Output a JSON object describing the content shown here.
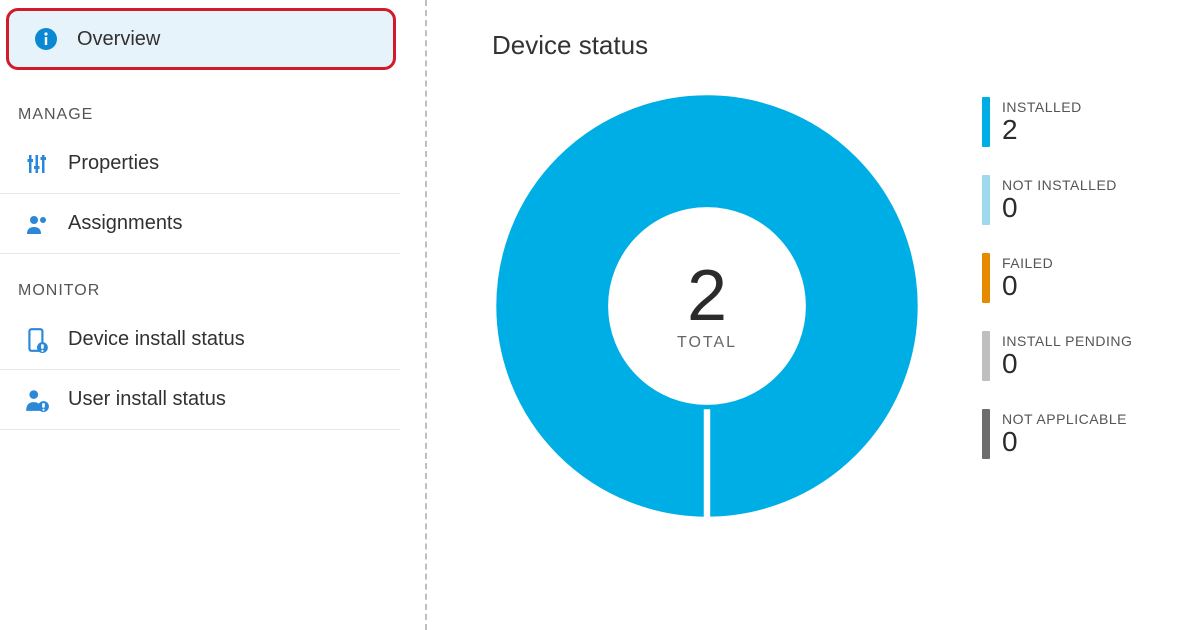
{
  "sidebar": {
    "overview_label": "Overview",
    "sections": {
      "manage": {
        "header": "MANAGE",
        "properties": "Properties",
        "assignments": "Assignments"
      },
      "monitor": {
        "header": "MONITOR",
        "device_install_status": "Device install status",
        "user_install_status": "User install status"
      }
    }
  },
  "panel": {
    "title": "Device status",
    "total_value": "2",
    "total_label": "TOTAL"
  },
  "legend": {
    "installed": {
      "label": "INSTALLED",
      "value": "2",
      "color": "#00aee6"
    },
    "not_installed": {
      "label": "NOT INSTALLED",
      "value": "0",
      "color": "#9ed9ec"
    },
    "failed": {
      "label": "FAILED",
      "value": "0",
      "color": "#e68a00"
    },
    "install_pending": {
      "label": "INSTALL PENDING",
      "value": "0",
      "color": "#bfbfbf"
    },
    "not_applicable": {
      "label": "NOT APPLICABLE",
      "value": "0",
      "color": "#6d6d6d"
    }
  },
  "chart_data": {
    "type": "pie",
    "title": "Device status",
    "categories": [
      "Installed",
      "Not installed",
      "Failed",
      "Install pending",
      "Not applicable"
    ],
    "values": [
      2,
      0,
      0,
      0,
      0
    ],
    "colors": [
      "#00aee6",
      "#9ed9ec",
      "#e68a00",
      "#bfbfbf",
      "#6d6d6d"
    ],
    "total": 2,
    "total_label": "TOTAL"
  }
}
